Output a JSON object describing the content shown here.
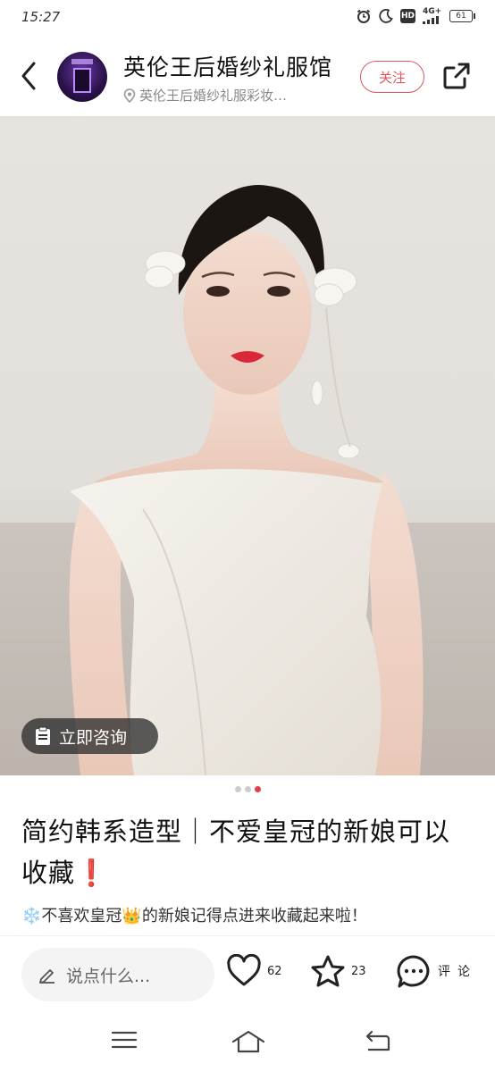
{
  "status_bar": {
    "time": "15:27",
    "hd_label": "HD",
    "network_label": "4G+",
    "battery_level": "61"
  },
  "header": {
    "shop_name": "英伦王后婚纱礼服馆",
    "location": "英伦王后婚纱礼服彩妆…",
    "follow_label": "关注"
  },
  "photo": {
    "consult_label": "立即咨询"
  },
  "carousel": {
    "count": 3,
    "active_index": 2
  },
  "post": {
    "title": "简约韩系造型｜不爱皇冠的新娘可以收藏❗",
    "description": "❄️不喜欢皇冠👑的新娘记得点进来收藏起来啦！"
  },
  "bottom_bar": {
    "comment_placeholder": "说点什么...",
    "likes": "62",
    "favorites": "23",
    "comment_chars": [
      "评",
      "论"
    ]
  },
  "colors": {
    "accent": "#e05560",
    "active_dot": "#e0404a"
  }
}
